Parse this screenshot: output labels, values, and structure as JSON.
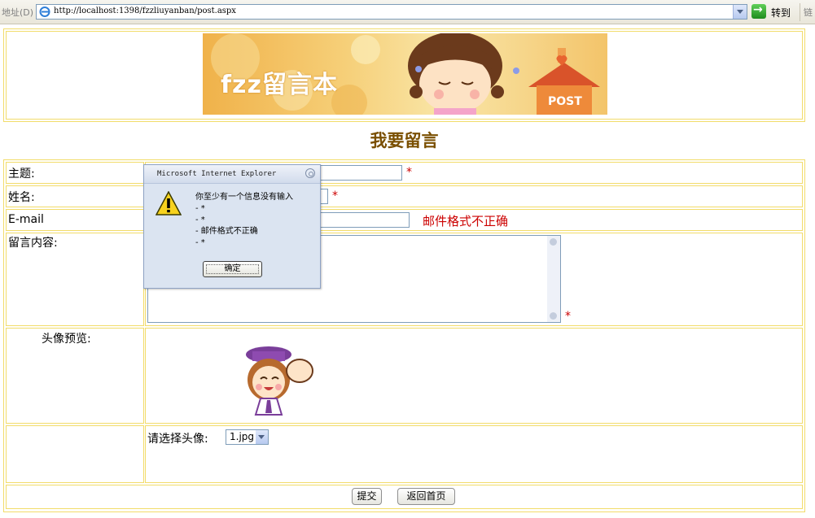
{
  "browser": {
    "address_label": "地址(D)",
    "url": "http://localhost:1398/fzzliuyanban/post.aspx",
    "go_label": "转到",
    "links_label": "链"
  },
  "banner": {
    "title": "fzz留言本",
    "post_label": "POST"
  },
  "page_title": "我要留言",
  "form": {
    "subject_label": "主题:",
    "name_label": "姓名:",
    "email_label": "E-mail",
    "content_label": "留言内容:",
    "avatar_preview_label": "头像预览:",
    "select_avatar_label": "请选择头像:",
    "avatar_selected": "1.jpg",
    "required_mark": "*",
    "email_error": "邮件格式不正确",
    "submit_label": "提交",
    "back_label": "返回首页"
  },
  "dialog": {
    "title": "Microsoft Internet Explorer",
    "message": "你至少有一个信息没有输入\n- *\n- *\n- 邮件格式不正确\n- *",
    "ok_label": "确定"
  },
  "colors": {
    "border": "#f2dc6a",
    "error": "#cc0000",
    "title": "#7a4f00"
  }
}
